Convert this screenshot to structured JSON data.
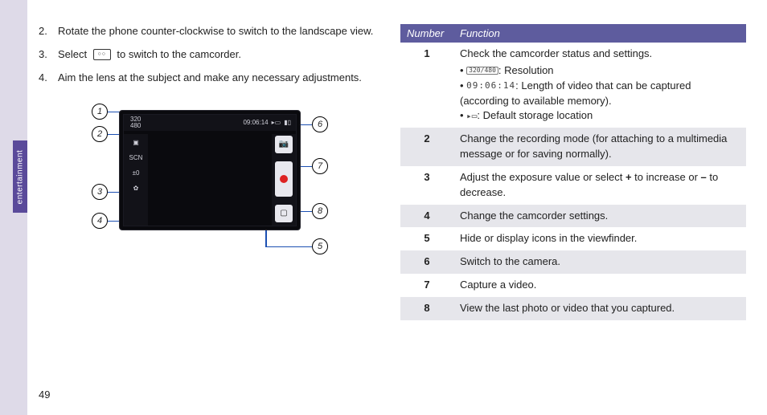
{
  "page_number": "49",
  "sidebar_label": "entertainment",
  "steps": [
    {
      "n": "2.",
      "text_a": "Rotate the phone counter-clockwise to switch to the landscape view."
    },
    {
      "n": "3.",
      "text_a": "Select ",
      "text_b": " to switch to the camcorder."
    },
    {
      "n": "4.",
      "text_a": "Aim the lens at the subject and make any necessary adjustments."
    }
  ],
  "diagram": {
    "callouts": [
      "1",
      "2",
      "3",
      "4",
      "5",
      "6",
      "7",
      "8"
    ],
    "topbar_res": "320\n480",
    "topbar_time": "09:06:14",
    "leftbar_items": [
      "▣",
      "SCN",
      "±0",
      "✿"
    ],
    "rightbar_items": [
      "📷",
      "●",
      "▢"
    ]
  },
  "fn_header": {
    "num": "Number",
    "fn": "Function"
  },
  "fn_rows": [
    {
      "n": "1",
      "text": "Check the camcorder status and settings.",
      "subs": [
        {
          "glyph": "320/480",
          "after": ": Resolution"
        },
        {
          "glyph": "09:06:14",
          "after": ": Length of video that can be captured (according to available memory)."
        },
        {
          "glyph": "▸▭",
          "after": ": Default storage location"
        }
      ]
    },
    {
      "n": "2",
      "text": "Change the recording mode (for attaching to a multimedia message or for saving normally)."
    },
    {
      "n": "3",
      "text_a": "Adjust the exposure value or select ",
      "bold1": "+",
      "text_b": " to increase or ",
      "bold2": "–",
      "text_c": " to decrease."
    },
    {
      "n": "4",
      "text": "Change the camcorder settings."
    },
    {
      "n": "5",
      "text": "Hide or display icons in the viewfinder."
    },
    {
      "n": "6",
      "text": "Switch to the camera."
    },
    {
      "n": "7",
      "text": "Capture a video."
    },
    {
      "n": "8",
      "text": "View the last photo or video that you captured."
    }
  ]
}
